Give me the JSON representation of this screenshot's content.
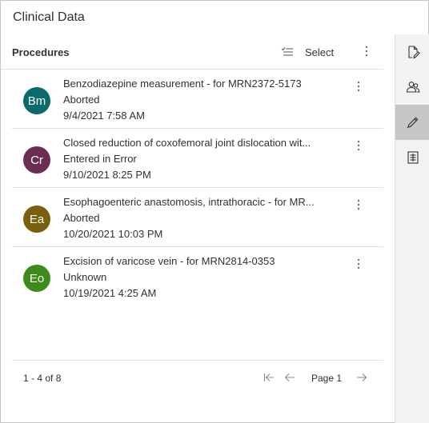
{
  "panel": {
    "title": "Clinical Data"
  },
  "header": {
    "title": "Procedures",
    "select_label": "Select"
  },
  "procedures": [
    {
      "initials": "Bm",
      "color": "#0b6a6a",
      "title": "Benzodiazepine measurement - for MRN2372-5173",
      "status": "Aborted",
      "date": "9/4/2021 7:58 AM"
    },
    {
      "initials": "Cr",
      "color": "#6b2d54",
      "title": "Closed reduction of coxofemoral joint dislocation wit...",
      "status": "Entered in Error",
      "date": "9/10/2021 8:25 PM"
    },
    {
      "initials": "Ea",
      "color": "#7a5f0d",
      "title": "Esophagoenteric anastomosis, intrathoracic - for MR...",
      "status": "Aborted",
      "date": "10/20/2021 10:03 PM"
    },
    {
      "initials": "Eo",
      "color": "#3d8b1a",
      "title": "Excision of varicose vein - for MRN2814-0353",
      "status": "Unknown",
      "date": "10/19/2021 4:25 AM"
    }
  ],
  "footer": {
    "count": "1 - 4 of 8",
    "page_label": "Page 1"
  },
  "icons": {
    "rail": [
      "document-edit-icon",
      "people-icon",
      "pen-icon",
      "list-document-icon"
    ],
    "header": [
      "select-list-icon",
      "more-vertical-icon"
    ],
    "pager": [
      "first-page-icon",
      "previous-page-icon",
      "next-page-icon"
    ]
  }
}
